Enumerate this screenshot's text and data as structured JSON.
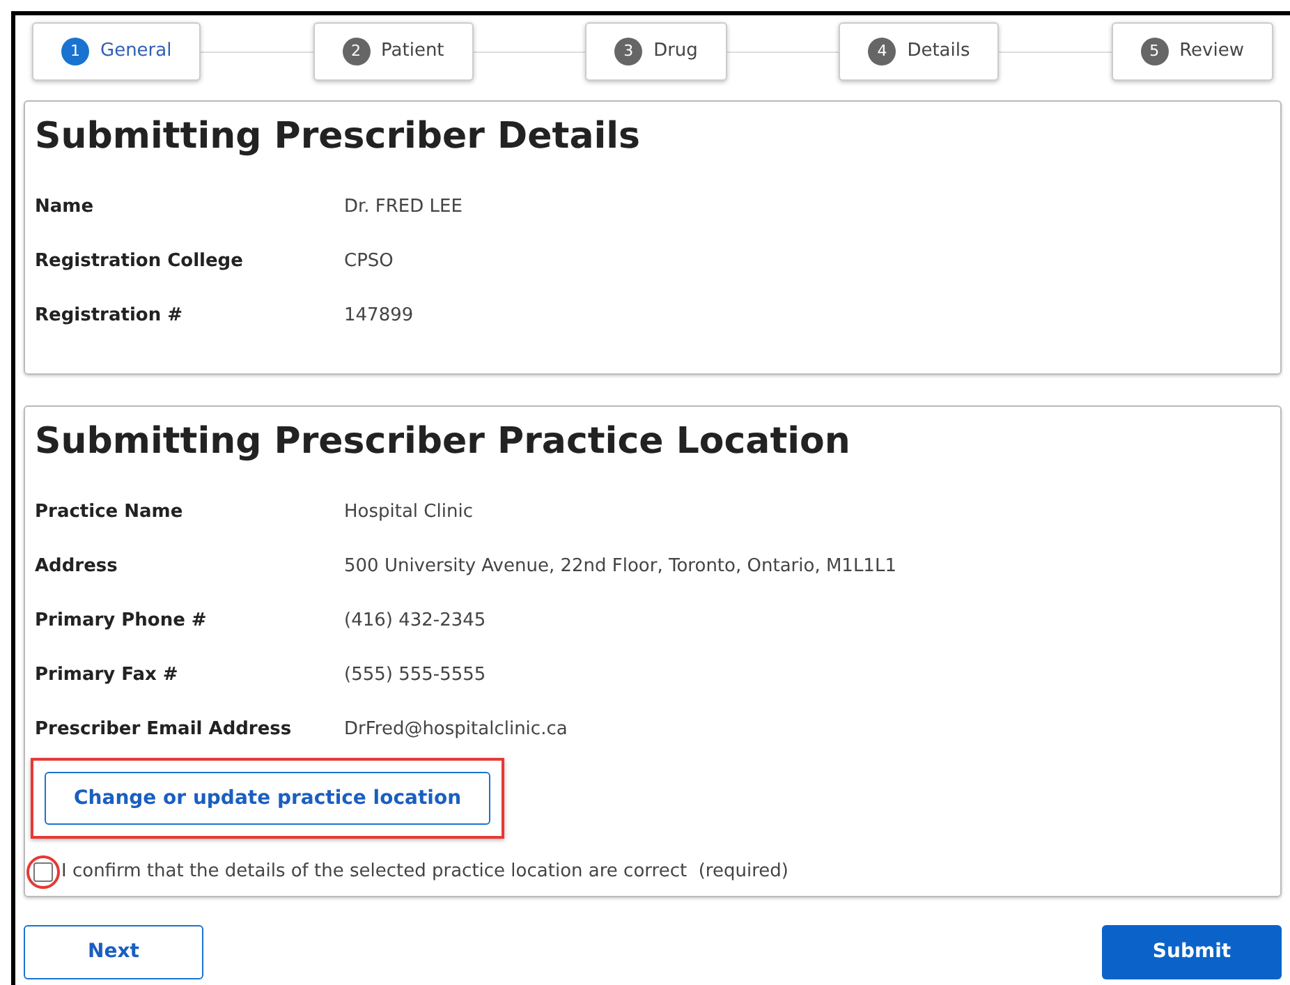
{
  "steps": [
    {
      "number": "1",
      "label": "General",
      "selected": true
    },
    {
      "number": "2",
      "label": "Patient",
      "selected": false
    },
    {
      "number": "3",
      "label": "Drug",
      "selected": false
    },
    {
      "number": "4",
      "label": "Details",
      "selected": false
    },
    {
      "number": "5",
      "label": "Review",
      "selected": false
    }
  ],
  "sections": [
    {
      "title": "Submitting Prescriber Details",
      "fields": [
        {
          "label": "Name",
          "value": "Dr. FRED LEE"
        },
        {
          "label": "Registration College",
          "value": "CPSO"
        },
        {
          "label": "Registration #",
          "value": "147899"
        }
      ]
    },
    {
      "title": "Submitting Prescriber Practice Location",
      "fields": [
        {
          "label": "Practice Name",
          "value": "Hospital Clinic"
        },
        {
          "label": "Address",
          "value": "500 University Avenue, 22nd Floor, Toronto, Ontario, M1L1L1"
        },
        {
          "label": "Primary Phone #",
          "value": "(416) 432-2345"
        },
        {
          "label": "Primary Fax #",
          "value": "(555) 555-5555"
        },
        {
          "label": "Prescriber Email Address",
          "value": "DrFred@hospitalclinic.ca"
        }
      ],
      "change_button": "Change or update practice location",
      "confirm": {
        "label": "I confirm that the details of the selected practice location are correct  (required)",
        "checked": false
      }
    }
  ],
  "buttons": {
    "next": "Next",
    "submit": "Submit"
  }
}
